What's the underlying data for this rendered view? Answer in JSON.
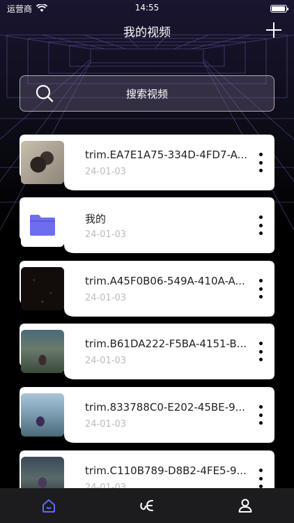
{
  "status_bar": {
    "carrier": "运营商",
    "time": "14:55",
    "battery_level": 0.9
  },
  "nav": {
    "title": "我的视频",
    "add_icon": "plus-icon"
  },
  "search": {
    "placeholder": "搜索视频",
    "icon": "search-icon"
  },
  "items": [
    {
      "title": "trim.EA7E1A75-334D-4FD7-A...",
      "date": "24-01-03",
      "thumb": "video-thumbnail-dog"
    },
    {
      "title": "我的",
      "date": "24-01-03",
      "thumb": "folder-icon"
    },
    {
      "title": "trim.A45F0B06-549A-410A-A...",
      "date": "24-01-03",
      "thumb": "video-thumbnail-dark"
    },
    {
      "title": "trim.B61DA222-F5BA-4151-B...",
      "date": "24-01-03",
      "thumb": "video-thumbnail-game-street"
    },
    {
      "title": "trim.833788C0-E202-45BE-9...",
      "date": "24-01-03",
      "thumb": "video-thumbnail-game-outdoor"
    },
    {
      "title": "trim.C110B789-D8B2-4FE5-9...",
      "date": "24-01-03",
      "thumb": "video-thumbnail-game-character"
    }
  ],
  "tab_bar": {
    "tabs": [
      {
        "name": "home",
        "icon": "home-icon",
        "active": true
      },
      {
        "name": "connect",
        "icon": "connect-icon",
        "active": false
      },
      {
        "name": "profile",
        "icon": "person-icon",
        "active": false
      }
    ],
    "active_color": "#5b6cff"
  },
  "colors": {
    "card_bg": "#ffffff",
    "folder_blue": "#6d6df0",
    "accent": "#5b6cff"
  }
}
